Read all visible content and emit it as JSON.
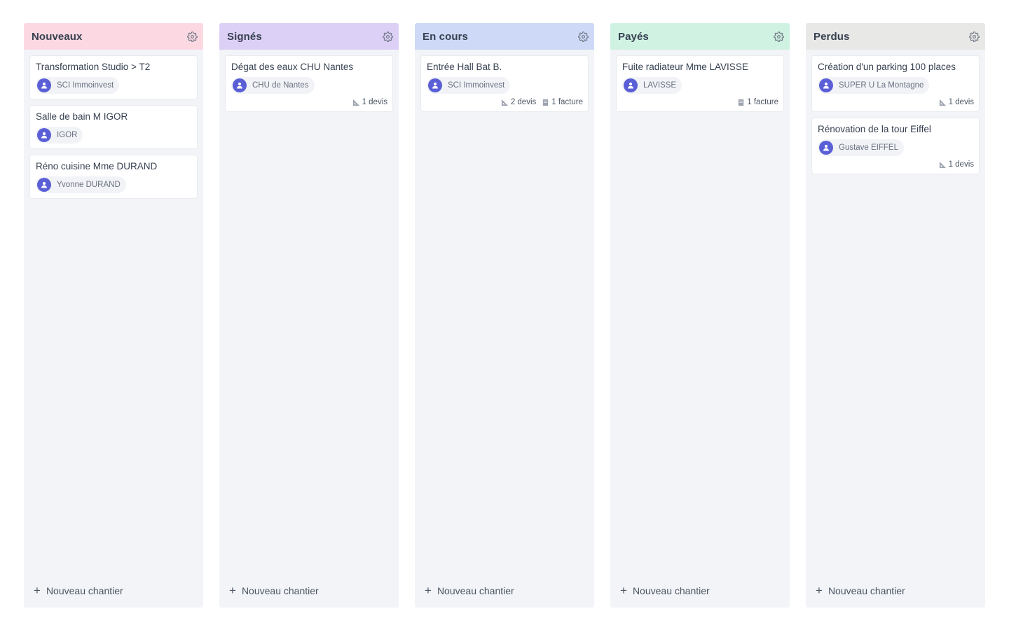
{
  "columns": [
    {
      "title": "Nouveaux",
      "color": "#fcd9e2",
      "add_label": "Nouveau chantier",
      "cards": [
        {
          "title": "Transformation Studio > T2",
          "client": "SCI Immoinvest",
          "devis": "",
          "facture": ""
        },
        {
          "title": "Salle de bain M IGOR",
          "client": "IGOR",
          "devis": "",
          "facture": ""
        },
        {
          "title": "Réno cuisine Mme DURAND",
          "client": "Yvonne DURAND",
          "devis": "",
          "facture": ""
        }
      ]
    },
    {
      "title": "Signés",
      "color": "#ddd0f6",
      "add_label": "Nouveau chantier",
      "cards": [
        {
          "title": "Dégat des eaux CHU Nantes",
          "client": "CHU de Nantes",
          "devis": "1 devis",
          "facture": ""
        }
      ]
    },
    {
      "title": "En cours",
      "color": "#cdd9f6",
      "add_label": "Nouveau chantier",
      "cards": [
        {
          "title": "Entrée Hall Bat B.",
          "client": "SCI Immoinvest",
          "devis": "2 devis",
          "facture": "1 facture"
        }
      ]
    },
    {
      "title": "Payés",
      "color": "#d0f2e2",
      "add_label": "Nouveau chantier",
      "cards": [
        {
          "title": "Fuite radiateur Mme LAVISSE",
          "client": "LAVISSE",
          "devis": "",
          "facture": "1 facture"
        }
      ]
    },
    {
      "title": "Perdus",
      "color": "#e8e8e6",
      "add_label": "Nouveau chantier",
      "cards": [
        {
          "title": "Création d'un parking 100 places",
          "client": "SUPER U La Montagne",
          "devis": "1 devis",
          "facture": ""
        },
        {
          "title": "Rénovation de la tour Eiffel",
          "client": "Gustave EIFFEL",
          "devis": "1 devis",
          "facture": ""
        }
      ]
    }
  ],
  "icons": {
    "settings": "gear-icon",
    "avatar": "user-icon",
    "devis": "devis-icon",
    "facture": "facture-icon",
    "add": "plus-icon"
  },
  "colors": {
    "column_bg": "#f2f4f8",
    "avatar": "#5b5fd6",
    "text": "#374151"
  }
}
